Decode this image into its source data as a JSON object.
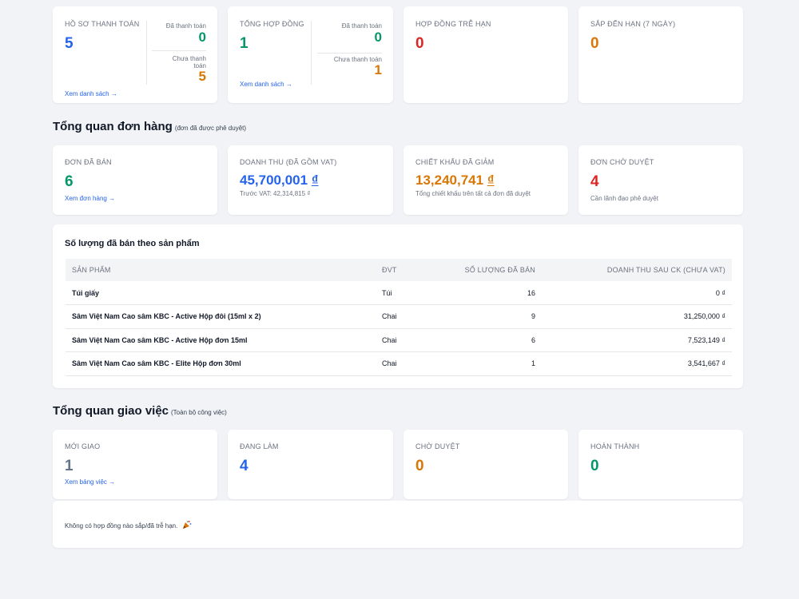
{
  "contracts_row": {
    "payment_files": {
      "label": "HỒ SƠ THANH TOÁN",
      "value": "5",
      "paid_label": "Đã thanh toán",
      "paid_value": "0",
      "unpaid_label_1": "Chưa thanh",
      "unpaid_label_2": "toán",
      "unpaid_value": "5",
      "link": "Xem danh sách →"
    },
    "contracts_total": {
      "label": "TỔNG HỢP ĐỒNG",
      "value": "1",
      "paid_label": "Đã thanh toán",
      "paid_value": "0",
      "unpaid_label": "Chưa thanh toán",
      "unpaid_value": "1",
      "link": "Xem danh sách →"
    },
    "overdue": {
      "label": "HỢP ĐỒNG TRỄ HẠN",
      "value": "0"
    },
    "due_soon": {
      "label": "SẮP ĐẾN HẠN (7 NGÀY)",
      "value": "0"
    }
  },
  "orders": {
    "title": "Tổng quan đơn hàng",
    "subtitle": "(đơn đã được phê duyệt)",
    "sold": {
      "label": "ĐƠN ĐÃ BÁN",
      "value": "6",
      "link": "Xem đơn hàng →"
    },
    "revenue": {
      "label": "DOANH THU (ĐÃ GỒM VAT)",
      "value": "45,700,001",
      "currency": "₫",
      "sub": "Trước VAT: 42,314,815 ₫"
    },
    "discount": {
      "label": "CHIẾT KHẤU ĐÃ GIẢM",
      "value": "13,240,741",
      "currency": "₫",
      "sub": "Tổng chiết khấu trên tất cả đơn đã duyệt"
    },
    "pending": {
      "label": "ĐƠN CHỜ DUYỆT",
      "value": "4",
      "sub": "Cần lãnh đạo phê duyệt"
    }
  },
  "products": {
    "title": "Số lượng đã bán theo sản phẩm",
    "columns": {
      "name": "SẢN PHẨM",
      "unit": "ĐVT",
      "qty": "SỐ LƯỢNG ĐÃ BÁN",
      "revenue": "DOANH THU SAU CK (CHƯA VAT)"
    },
    "rows": [
      {
        "name": "Túi giấy",
        "unit": "Túi",
        "qty": "16",
        "revenue": "0 ₫"
      },
      {
        "name": "Sâm Việt Nam Cao sâm KBC - Active Hộp đôi (15ml x 2)",
        "unit": "Chai",
        "qty": "9",
        "revenue": "31,250,000 ₫"
      },
      {
        "name": "Sâm Việt Nam Cao sâm KBC - Active Hộp đơn 15ml",
        "unit": "Chai",
        "qty": "6",
        "revenue": "7,523,149 ₫"
      },
      {
        "name": "Sâm Việt Nam Cao sâm KBC - Elite Hộp đơn 30ml",
        "unit": "Chai",
        "qty": "1",
        "revenue": "3,541,667 ₫"
      }
    ]
  },
  "tasks": {
    "title": "Tổng quan giao việc",
    "subtitle": "(Toàn bộ công việc)",
    "new": {
      "label": "MỚI GIAO",
      "value": "1",
      "link": "Xem bảng việc →"
    },
    "doing": {
      "label": "ĐANG LÀM",
      "value": "4"
    },
    "review": {
      "label": "CHỜ DUYỆT",
      "value": "0"
    },
    "done": {
      "label": "HOÀN THÀNH",
      "value": "0"
    }
  },
  "notice": {
    "text": "Không có hợp đồng nào sắp/đã trễ hạn.",
    "icon": "party-popper-icon"
  },
  "colors": {
    "blue": "#2563eb",
    "green": "#059669",
    "red": "#dc2626",
    "orange": "#d97706",
    "gray": "#64748b"
  }
}
